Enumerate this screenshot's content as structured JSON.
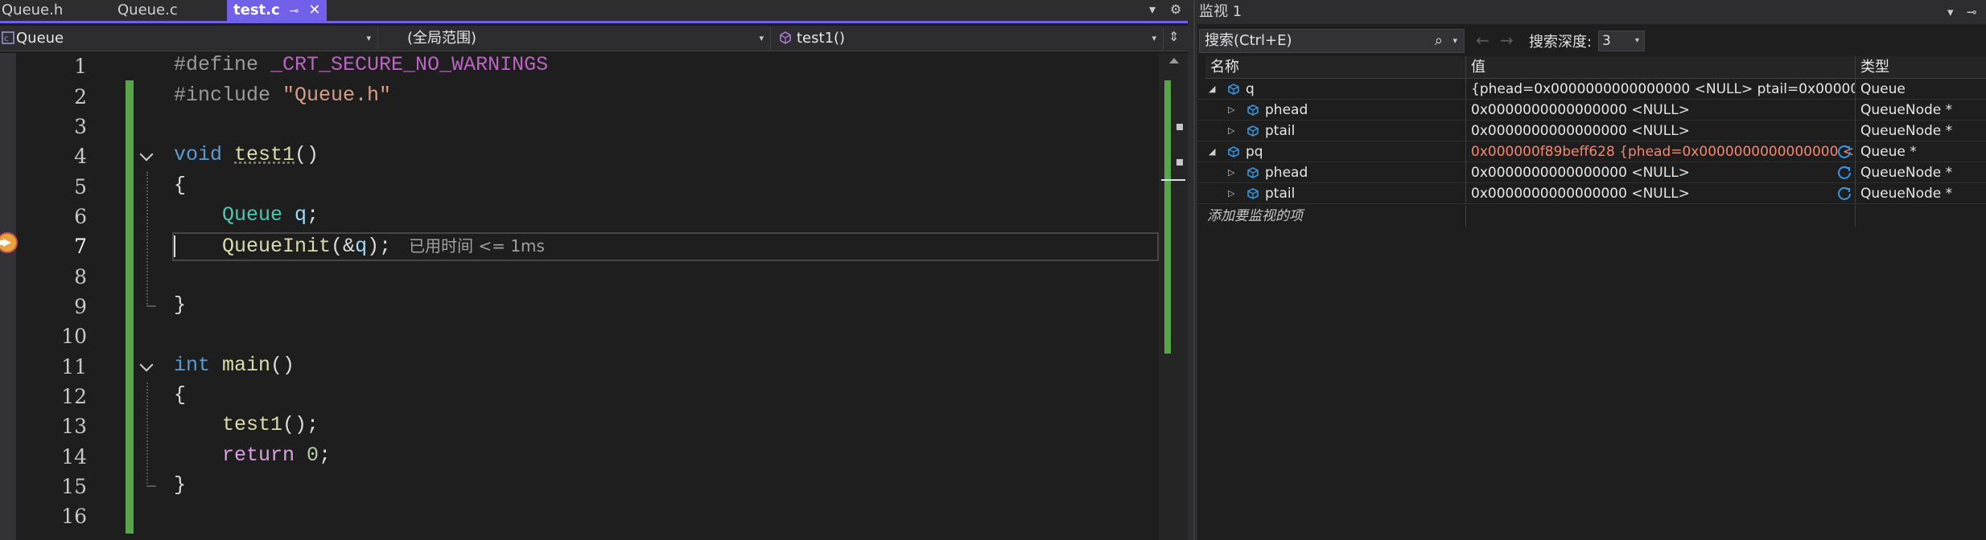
{
  "editor": {
    "tabs": [
      {
        "label": "Queue.h"
      },
      {
        "label": "Queue.c"
      },
      {
        "label": "test.c",
        "active": true,
        "pin_glyph": "⊸",
        "close_glyph": "✕"
      }
    ],
    "nav": {
      "project": "Queue",
      "scope": "(全局范围)",
      "member": "test1()"
    },
    "line_numbers": [
      "1",
      "2",
      "3",
      "4",
      "5",
      "6",
      "7",
      "8",
      "9",
      "10",
      "11",
      "12",
      "13",
      "14",
      "15",
      "16"
    ],
    "current_line": "7",
    "inline_hint": "已用时间 <= 1ms",
    "code": {
      "l1_pre": "#define ",
      "l1_macro": "_CRT_SECURE_NO_WARNINGS",
      "l2_pre": "#include ",
      "l2_str": "\"Queue.h\"",
      "l4_kw": "void",
      "l4_fn": "test1",
      "l4_rest": "()",
      "l5": "{",
      "l6_type": "Queue",
      "l6_var": "q",
      "l6_end": ";",
      "l7_fn": "QueueInit",
      "l7_open": "(&",
      "l7_var": "q",
      "l7_end": ");",
      "l9": "}",
      "l11_kw": "int",
      "l11_fn": "main",
      "l11_rest": "()",
      "l12": "{",
      "l13_fn": "test1",
      "l13_rest": "();",
      "l14_kw": "return",
      "l14_num": "0",
      "l14_end": ";",
      "l15": "}"
    }
  },
  "watch": {
    "title": "监视 1",
    "search_placeholder": "搜索(Ctrl+E)",
    "depth_label": "搜索深度:",
    "depth_value": "3",
    "columns": {
      "name": "名称",
      "value": "值",
      "type": "类型"
    },
    "rows": [
      {
        "name": "q",
        "value": "{phead=0x0000000000000000 <NULL> ptail=0x00000000...",
        "type": "Queue",
        "level": 0,
        "expanded": true,
        "refresh": false,
        "red": false
      },
      {
        "name": "phead",
        "value": "0x0000000000000000 <NULL>",
        "type": "QueueNode *",
        "level": 1,
        "expanded": false,
        "refresh": false,
        "red": false
      },
      {
        "name": "ptail",
        "value": "0x0000000000000000 <NULL>",
        "type": "QueueNode *",
        "level": 1,
        "expanded": false,
        "refresh": false,
        "red": false
      },
      {
        "name": "pq",
        "value": "0x000000f89beff628 {phead=0x0000000000000000 <...",
        "type": "Queue *",
        "level": 0,
        "expanded": true,
        "refresh": true,
        "red": true
      },
      {
        "name": "phead",
        "value": "0x0000000000000000 <NULL>",
        "type": "QueueNode *",
        "level": 1,
        "expanded": false,
        "refresh": true,
        "red": false
      },
      {
        "name": "ptail",
        "value": "0x0000000000000000 <NULL>",
        "type": "QueueNode *",
        "level": 1,
        "expanded": false,
        "refresh": true,
        "red": false
      }
    ],
    "add_item": "添加要监视的项"
  },
  "colors": {
    "accent": "#7160e8",
    "change_bar": "#57a64a",
    "object_icon": "#3a96dd",
    "error_value": "#f48771"
  },
  "icons": {
    "tab_overflow": "▾",
    "settings": "⚙",
    "split": "⇕",
    "dropdown": "▾",
    "search": "⌕",
    "back": "←",
    "forward": "→",
    "panel_menu": "▾",
    "panel_pin": "⊸",
    "expand_open": "◢",
    "expand_closed": "▷"
  }
}
